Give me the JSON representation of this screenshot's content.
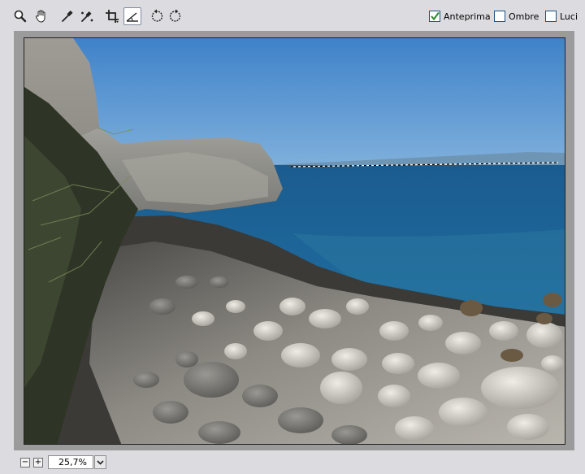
{
  "toolbar": {
    "tools": [
      {
        "name": "zoom-tool",
        "icon": "magnifier-icon"
      },
      {
        "name": "hand-tool",
        "icon": "hand-icon"
      },
      {
        "name": "eyedropper-tool",
        "icon": "eyedropper-icon"
      },
      {
        "name": "color-sampler-tool",
        "icon": "color-sampler-icon"
      },
      {
        "name": "crop-tool",
        "icon": "crop-icon"
      },
      {
        "name": "straighten-tool",
        "icon": "straighten-icon",
        "active": true
      },
      {
        "name": "rotate-left-tool",
        "icon": "rotate-ccw-icon"
      },
      {
        "name": "rotate-right-tool",
        "icon": "rotate-cw-icon"
      }
    ],
    "options": [
      {
        "label": "Anteprima",
        "checked": true
      },
      {
        "label": "Ombre",
        "checked": false
      },
      {
        "label": "Luci",
        "checked": false
      }
    ]
  },
  "zoom": {
    "value": "25,7%",
    "decrease_icon": "minus-icon",
    "increase_icon": "plus-icon",
    "dropdown_icon": "chevron-down-icon"
  },
  "colors": {
    "accent": "#1c5180",
    "check": "#2a8a2a"
  }
}
